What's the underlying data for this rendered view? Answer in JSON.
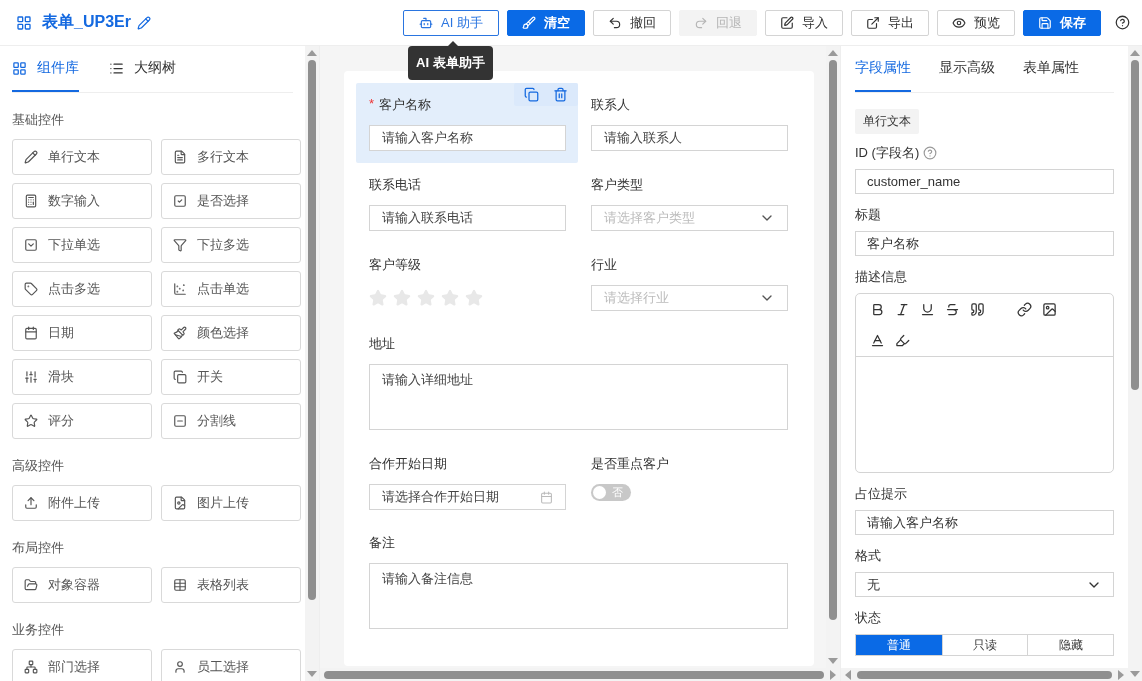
{
  "header": {
    "title": "表单_UP3Er",
    "tooltip": "AI 表单助手",
    "buttons": [
      {
        "label": "AI 助手",
        "kind": "outline"
      },
      {
        "label": "清空",
        "kind": "primary"
      },
      {
        "label": "撤回",
        "kind": "default"
      },
      {
        "label": "回退",
        "kind": "disabled"
      },
      {
        "label": "导入",
        "kind": "default"
      },
      {
        "label": "导出",
        "kind": "default"
      },
      {
        "label": "预览",
        "kind": "default"
      },
      {
        "label": "保存",
        "kind": "primary"
      }
    ]
  },
  "left_panel": {
    "tabs": [
      {
        "label": "组件库",
        "selected": true
      },
      {
        "label": "大纲树",
        "selected": false
      }
    ],
    "groups": [
      {
        "title": "基础控件",
        "items": [
          "单行文本",
          "多行文本",
          "数字输入",
          "是否选择",
          "下拉单选",
          "下拉多选",
          "点击多选",
          "点击单选",
          "日期",
          "颜色选择",
          "滑块",
          "开关",
          "评分",
          "分割线"
        ]
      },
      {
        "title": "高级控件",
        "items": [
          "附件上传",
          "图片上传"
        ]
      },
      {
        "title": "布局控件",
        "items": [
          "对象容器",
          "表格列表"
        ]
      },
      {
        "title": "业务控件",
        "items": [
          "部门选择",
          "员工选择"
        ]
      }
    ]
  },
  "canvas": {
    "fields": [
      {
        "label": "客户名称",
        "kind": "input",
        "placeholder": "请输入客户名称",
        "required_mark": "*",
        "selected": true
      },
      {
        "label": "联系人",
        "kind": "input",
        "placeholder": "请输入联系人",
        "selected": false
      },
      {
        "label": "联系电话",
        "kind": "input",
        "placeholder": "请输入联系电话",
        "selected": false
      },
      {
        "label": "客户类型",
        "kind": "select",
        "placeholder": "请选择客户类型",
        "selected": false
      },
      {
        "label": "客户等级",
        "kind": "rate",
        "stars": 0,
        "selected": false
      },
      {
        "label": "行业",
        "kind": "select",
        "placeholder": "请选择行业",
        "selected": false
      },
      {
        "label": "地址",
        "kind": "textarea",
        "placeholder": "请输入详细地址",
        "selected": false
      },
      {
        "label": "合作开始日期",
        "kind": "date",
        "placeholder": "请选择合作开始日期",
        "selected": false
      },
      {
        "label": "是否重点客户",
        "kind": "switch",
        "on": false,
        "switch_text": "否",
        "selected": false
      },
      {
        "label": "备注",
        "kind": "textarea",
        "placeholder": "请输入备注信息",
        "selected": false
      }
    ]
  },
  "right_panel": {
    "tabs": [
      {
        "label": "字段属性",
        "selected": true
      },
      {
        "label": "显示高级",
        "selected": false
      },
      {
        "label": "表单属性",
        "selected": false
      }
    ],
    "type_tag": "单行文本",
    "id_label": "ID (字段名)",
    "id_value": "customer_name",
    "title_label": "标题",
    "title_value": "客户名称",
    "description_label": "描述信息",
    "placeholder_label": "占位提示",
    "placeholder_value": "请输入客户名称",
    "format_label": "格式",
    "format_value": "无",
    "status_label": "状态",
    "status_options": [
      {
        "label": "普通",
        "selected": true
      },
      {
        "label": "只读",
        "selected": false
      },
      {
        "label": "隐藏",
        "selected": false
      }
    ]
  }
}
